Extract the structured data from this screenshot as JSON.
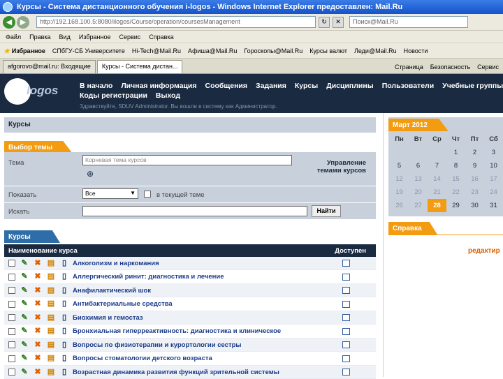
{
  "window": {
    "title": "Курсы - Система дистанционного обучения i-logos - Windows Internet Explorer предоставлен: Mail.Ru"
  },
  "address": {
    "url": "http://192.168.100.5:8080/ilogos/Course/operation/coursesManagement",
    "search_placeholder": "Поиск@Mail.Ru"
  },
  "menu": [
    "Файл",
    "Правка",
    "Вид",
    "Избранное",
    "Сервис",
    "Справка"
  ],
  "favorites": [
    "Избранное",
    "СПбГУ-СБ Университете",
    "Hi-Tech@Mail.Ru",
    "Афиша@Mail.Ru",
    "Гороскопы@Mail.Ru",
    "Курсы валют",
    "Леди@Mail.Ru",
    "Новости"
  ],
  "tabs": [
    "afgorovo@mail.ru: Входящие",
    "Курсы - Система дистан..."
  ],
  "tab_tools": [
    "Страница",
    "Безопасность",
    "Сервис"
  ],
  "site": {
    "logo": "logos",
    "nav_row1": [
      "В начало",
      "Личная информация",
      "Сообщения",
      "Задания",
      "Курсы",
      "Дисциплины",
      "Пользователи",
      "Учебные группы"
    ],
    "nav_row2": [
      "Коды регистрации",
      "Выход"
    ],
    "welcome": "Здравствуйте, SDUV Administrator. Вы вошли в систему как Администратор."
  },
  "breadcrumb": "Курсы",
  "topic": {
    "header": "Выбор темы",
    "theme_label": "Тема",
    "theme_value": "Корневая тема курсов",
    "show_label": "Показать",
    "show_value": "Все",
    "in_current_label": "в текущей теме",
    "search_label": "Искать",
    "search_button": "Найти",
    "manage_line1": "Управление",
    "manage_line2": "темами курсов"
  },
  "courses": {
    "header": "Курсы",
    "col_name": "Наименование курса",
    "col_available": "Доступен",
    "rows": [
      "Алкоголизм и наркомания",
      "Аллергический ринит: диагностика и лечение",
      "Анафилактический шок",
      "Антибактериальные средства",
      "Биохимия и гемостаз",
      "Бронхиальная гиперреактивность: диагностика и клиническое",
      "Вопросы по физиотерапии и курортологии сестры",
      "Вопросы стоматологии детского возраста",
      "Возрастная динамика развития функций зрительной системы"
    ]
  },
  "calendar": {
    "title": "Март 2012",
    "weekdays": [
      "Пн",
      "Вт",
      "Ср",
      "Чт",
      "Пт",
      "Сб"
    ],
    "weeks": [
      [
        "",
        "",
        "",
        "1",
        "2",
        "3"
      ],
      [
        "5",
        "6",
        "7",
        "8",
        "9",
        "10"
      ],
      [
        "12",
        "13",
        "14",
        "15",
        "16",
        "17"
      ],
      [
        "19",
        "20",
        "21",
        "22",
        "23",
        "24"
      ],
      [
        "26",
        "27",
        "28",
        "29",
        "30",
        "31"
      ]
    ],
    "today": "28"
  },
  "help": {
    "header": "Справка",
    "edit": "редактир"
  },
  "colors": {
    "orange": "#f39c12",
    "navy": "#1a2a40",
    "panel": "#c8d0dc"
  }
}
